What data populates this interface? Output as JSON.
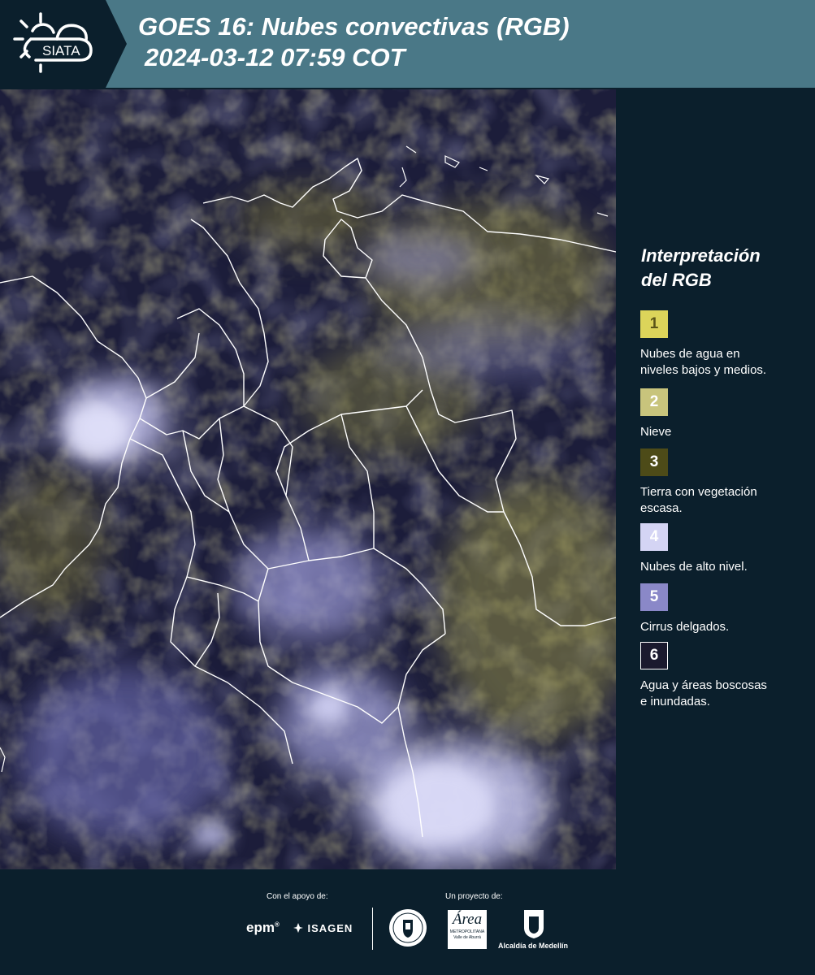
{
  "header": {
    "brand": "SIATA",
    "title_line1": "GOES 16: Nubes convectivas (RGB)",
    "title_line2": "2024-03-12 07:59 COT"
  },
  "map": {
    "icon": "satellite-map-image",
    "border_color": "#ffffff"
  },
  "legend": {
    "title_line1": "Interpretación",
    "title_line2": "del RGB",
    "items": [
      {
        "number": "1",
        "label_line1": "Nubes de agua en",
        "label_line2": "niveles bajos y medios.",
        "color": "#dcd45a",
        "text_color": "#5a5418"
      },
      {
        "number": "2",
        "label_line1": "Nieve",
        "label_line2": "",
        "color": "#c8c47c",
        "text_color": "#ffffff"
      },
      {
        "number": "3",
        "label_line1": "Tierra con vegetación",
        "label_line2": "escasa.",
        "color": "#4d4b18",
        "text_color": "#ffffff"
      },
      {
        "number": "4",
        "label_line1": "Nubes de alto nivel.",
        "label_line2": "",
        "color": "#d4d4f4",
        "text_color": "#ffffff"
      },
      {
        "number": "5",
        "label_line1": "Cirrus delgados.",
        "label_line2": "",
        "color": "#8a88c8",
        "text_color": "#ffffff"
      },
      {
        "number": "6",
        "label_line1": "Agua y áreas boscosas",
        "label_line2": "e inundadas.",
        "color": "#1a1a2e",
        "text_color": "#ffffff"
      }
    ]
  },
  "footer": {
    "support_label": "Con el apoyo de:",
    "project_label": "Un proyecto de:",
    "sponsor1": "epm",
    "sponsor2": "ISAGEN",
    "partner1_name": "Área",
    "partner1_sub1": "METROPOLITANA",
    "partner1_sub2": "Valle de Aburrá",
    "partner2": "Alcaldía de Medellín"
  }
}
